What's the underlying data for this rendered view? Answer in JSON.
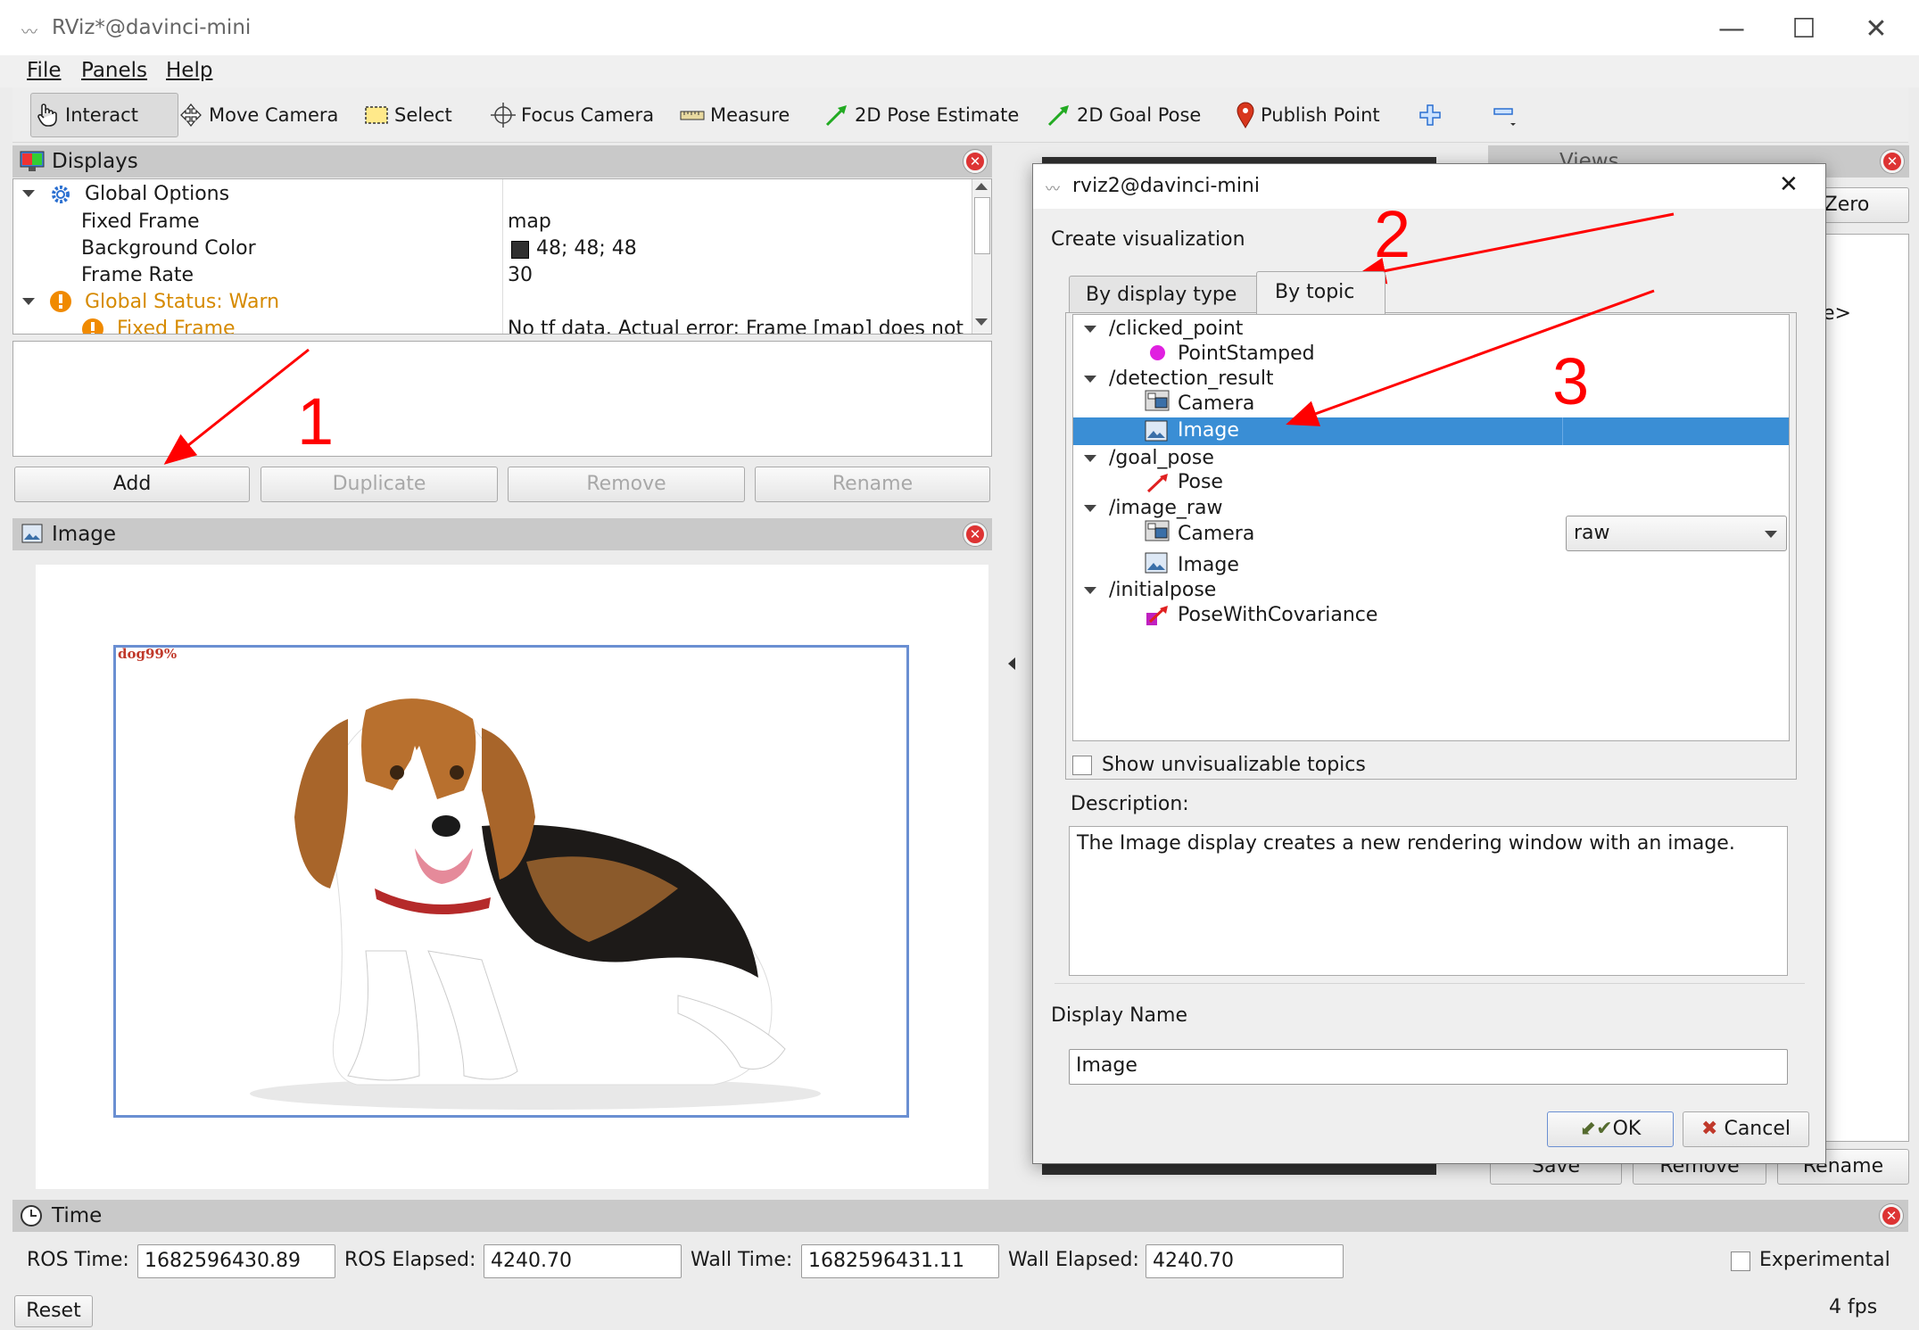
{
  "window": {
    "title": "RViz*@davinci-mini",
    "minimize": "—",
    "maximize": "☐",
    "close": "✕"
  },
  "menu": {
    "file": "File",
    "panels": "Panels",
    "help": "Help"
  },
  "toolbar": {
    "interact": "Interact",
    "move_camera": "Move Camera",
    "select": "Select",
    "focus_camera": "Focus Camera",
    "measure": "Measure",
    "pose_estimate": "2D Pose Estimate",
    "goal_pose": "2D Goal Pose",
    "publish_point": "Publish Point"
  },
  "displays": {
    "title": "Displays",
    "global_options": "Global Options",
    "fixed_frame_label": "Fixed Frame",
    "fixed_frame_value": "map",
    "bg_color_label": "Background Color",
    "bg_color_value": "48; 48; 48",
    "bg_color_swatch": "#303030",
    "frame_rate_label": "Frame Rate",
    "frame_rate_value": "30",
    "global_status": "Global Status: Warn",
    "fixed_frame_status": "Fixed Frame",
    "fixed_frame_status_value": "No tf data.  Actual error: Frame [map] does not",
    "buttons": {
      "add": "Add",
      "duplicate": "Duplicate",
      "remove": "Remove",
      "rename": "Rename"
    }
  },
  "image_panel": {
    "title": "Image",
    "bbox_label": "dog99%"
  },
  "views": {
    "title": "Views",
    "zero": "Zero",
    "partial": "e>",
    "save": "Save",
    "remove": "Remove",
    "rename": "Rename"
  },
  "annotations": {
    "one": "1",
    "two": "2",
    "three": "3"
  },
  "dialog": {
    "title": "rviz2@davinci-mini",
    "close": "✕",
    "section": "Create visualization",
    "tab_display_type": "By display type",
    "tab_topic": "By topic",
    "topics": [
      {
        "name": "/clicked_point",
        "children": [
          "PointStamped"
        ]
      },
      {
        "name": "/detection_result",
        "children": [
          "Camera",
          "Image"
        ]
      },
      {
        "name": "/goal_pose",
        "children": [
          "Pose"
        ]
      },
      {
        "name": "/image_raw",
        "children": [
          "Camera",
          "Image"
        ]
      },
      {
        "name": "/initialpose",
        "children": [
          "PoseWithCovariance"
        ]
      }
    ],
    "camera_option": "raw",
    "show_unvisualizable": "Show unvisualizable topics",
    "description_label": "Description:",
    "description": "The Image display creates a new rendering window with an image.",
    "display_name_label": "Display Name",
    "display_name_value": "Image",
    "ok": "OK",
    "cancel": "Cancel"
  },
  "time": {
    "title": "Time",
    "ros_time_label": "ROS Time:",
    "ros_time_value": "1682596430.89",
    "ros_elapsed_label": "ROS Elapsed:",
    "ros_elapsed_value": "4240.70",
    "wall_time_label": "Wall Time:",
    "wall_time_value": "1682596431.11",
    "wall_elapsed_label": "Wall Elapsed:",
    "wall_elapsed_value": "4240.70",
    "experimental": "Experimental",
    "reset": "Reset",
    "fps": "4 fps"
  },
  "colors": {
    "selection": "#3a8ed5",
    "warn": "#d68a00",
    "annotation": "#ff0000"
  }
}
